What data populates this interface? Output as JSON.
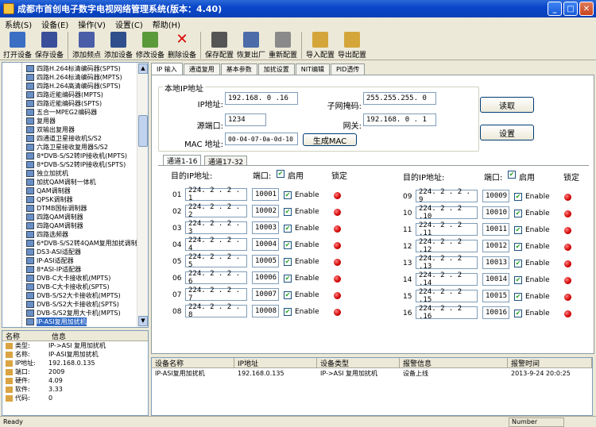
{
  "window": {
    "title": "成都市首创电子数字电视网络管理系统(版本：4.40)"
  },
  "menu": [
    "系统(S)",
    "设备(E)",
    "操作(V)",
    "设置(C)",
    "帮助(H)"
  ],
  "toolbar": [
    "打开设备",
    "保存设备",
    "添加频点",
    "添加设备",
    "修改设备",
    "删除设备",
    "保存配置",
    "恢复出厂",
    "重新配置",
    "导入配置",
    "导出配置"
  ],
  "tree": [
    "四路H.264标清编码器(SPTS)",
    "四路H.264标清编码器(MPTS)",
    "四路H.264高清编码器(SPTS)",
    "四路近能编码器(MPTS)",
    "四路近能编码器(SPTS)",
    "五合一MPEG2编码器",
    "复用器",
    "双输出复用器",
    "四通道卫星接收机S/S2",
    "六路卫星接收复用器S/S2",
    "8*DVB-S/S2转IP接收机(MPTS)",
    "8*DVB-S/S2转IP接收机(SPTS)",
    "独立加扰机",
    "加扰QAM调制一体机",
    "QAM调制器",
    "QPSK调制器",
    "DTMB国标调制器",
    "四路QAM调制器",
    "四路QAM调制器",
    "四路选频器",
    "6*DVB-S/S2转4QAM复用加扰调制器",
    "DS3-ASI适配器",
    "IP-ASI适配器",
    "8*ASI-IP适配器",
    "DVB-C大卡接收机(MPTS)",
    "DVB-C大卡接收机(SPTS)",
    "DVB-S/S2大卡接收机(MPTS)",
    "DVB-S/S2大卡接收机(SPTS)",
    "DVB-S/S2复用大卡机(MPTS)",
    "IP-ASI复用加扰机"
  ],
  "info": {
    "headers": [
      "名称",
      "信息"
    ],
    "rows": [
      {
        "k": "类型:",
        "v": "IP->ASI 复用加扰机"
      },
      {
        "k": "名称:",
        "v": "IP-ASI复用加扰机"
      },
      {
        "k": "IP地址:",
        "v": "192.168.0.135"
      },
      {
        "k": "端口:",
        "v": "2009"
      },
      {
        "k": "硬件:",
        "v": "4.09"
      },
      {
        "k": "软件:",
        "v": "3.33"
      },
      {
        "k": "代码:",
        "v": "0"
      }
    ]
  },
  "tabs": [
    "IP 输入",
    "通道复用",
    "基本参数",
    "加扰设置",
    "NIT编辑",
    "PID透传"
  ],
  "local": {
    "group": "本地IP地址",
    "ip_label": "IP地址:",
    "ip": "192.168. 0 .16",
    "mask_label": "子网掩码:",
    "mask": "255.255.255. 0",
    "port_label": "源端口:",
    "port": "1234",
    "gw_label": "网关:",
    "gw": "192.168. 0 . 1",
    "mac_label": "MAC 地址:",
    "mac": "00-04-07-0a-0d-10",
    "gen_mac": "生成MAC",
    "read": "读取",
    "set": "设置"
  },
  "subtabs": [
    "通道1-16",
    "通道17-32"
  ],
  "headers": {
    "dest": "目的IP地址:",
    "port": "端口:",
    "enable": "启用",
    "lock": "锁定"
  },
  "enable_label": "Enable",
  "channels_left": [
    {
      "n": "01",
      "ip": "224. 2 . 2 . 1",
      "port": "10001"
    },
    {
      "n": "02",
      "ip": "224. 2 . 2 . 2",
      "port": "10002"
    },
    {
      "n": "03",
      "ip": "224. 2 . 2 . 3",
      "port": "10003"
    },
    {
      "n": "04",
      "ip": "224. 2 . 2 . 4",
      "port": "10004"
    },
    {
      "n": "05",
      "ip": "224. 2 . 2 . 5",
      "port": "10005"
    },
    {
      "n": "06",
      "ip": "224. 2 . 2 . 6",
      "port": "10006"
    },
    {
      "n": "07",
      "ip": "224. 2 . 2 . 7",
      "port": "10007"
    },
    {
      "n": "08",
      "ip": "224. 2 . 2 . 8",
      "port": "10008"
    }
  ],
  "channels_right": [
    {
      "n": "09",
      "ip": "224. 2 . 2 . 9",
      "port": "10009"
    },
    {
      "n": "10",
      "ip": "224. 2 . 2 .10",
      "port": "10010"
    },
    {
      "n": "11",
      "ip": "224. 2 . 2 .11",
      "port": "10011"
    },
    {
      "n": "12",
      "ip": "224. 2 . 2 .12",
      "port": "10012"
    },
    {
      "n": "13",
      "ip": "224. 2 . 2 .13",
      "port": "10013"
    },
    {
      "n": "14",
      "ip": "224. 2 . 2 .14",
      "port": "10014"
    },
    {
      "n": "15",
      "ip": "224. 2 . 2 .15",
      "port": "10015"
    },
    {
      "n": "16",
      "ip": "224. 2 . 2 .16",
      "port": "10016"
    }
  ],
  "log": {
    "headers": [
      "设备名称",
      "IP地址",
      "设备类型",
      "报警信息",
      "报警时间"
    ],
    "rows": [
      {
        "name": "IP-ASI复用加扰机",
        "ip": "192.168.0.135",
        "type": "IP->ASI 复用加扰机",
        "alarm": "设备上线",
        "time": "2013-9-24 20:0:25"
      }
    ]
  },
  "status": {
    "left": "Ready",
    "right": "Number"
  }
}
